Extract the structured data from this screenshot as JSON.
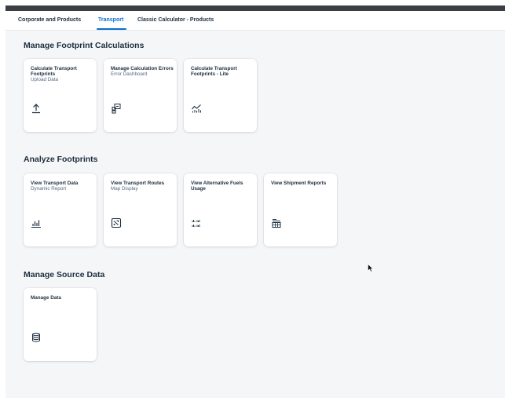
{
  "tabs": [
    {
      "label": "Corporate and Products",
      "active": false
    },
    {
      "label": "Transport",
      "active": true
    },
    {
      "label": "Classic Calculator - Products",
      "active": false
    }
  ],
  "accent_color": "#0a6ed1",
  "sections": [
    {
      "title": "Manage Footprint Calculations",
      "tiles": [
        {
          "title": "Calculate Transport Footprints",
          "subtitle": "Upload Data",
          "icon": "upload-icon"
        },
        {
          "title": "Manage Calculation Errors",
          "subtitle": "Error Dashboard",
          "icon": "error-dashboard-icon"
        },
        {
          "title": "Calculate Transport Footprints - Lite",
          "subtitle": "",
          "icon": "line-chart-icon"
        }
      ]
    },
    {
      "title": "Analyze Footprints",
      "tiles": [
        {
          "title": "View Transport Data",
          "subtitle": "Dynamic Report",
          "icon": "bar-chart-icon"
        },
        {
          "title": "View Transport Routes",
          "subtitle": "Map Display",
          "icon": "map-icon"
        },
        {
          "title": "View Alternative Fuels Usage",
          "subtitle": "",
          "icon": "multi-bar-chart-icon"
        },
        {
          "title": "View Shipment Reports",
          "subtitle": "",
          "icon": "table-report-icon"
        }
      ]
    },
    {
      "title": "Manage Source Data",
      "tiles": [
        {
          "title": "Manage Data",
          "subtitle": "",
          "icon": "database-icon"
        }
      ]
    }
  ]
}
